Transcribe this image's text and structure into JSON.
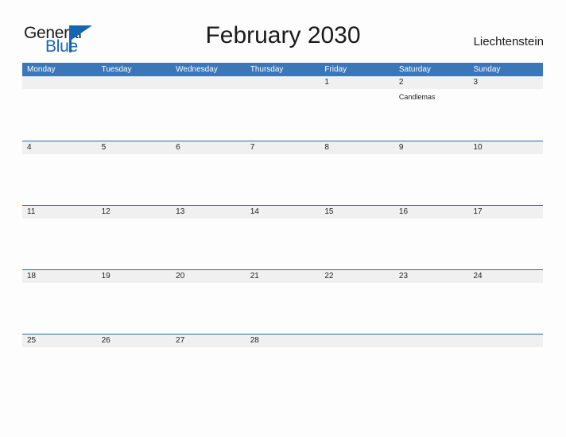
{
  "brand": {
    "name_part1": "General",
    "name_part2": "Blue",
    "accent_color": "#1565b0"
  },
  "header": {
    "title": "February 2030",
    "region": "Liechtenstein"
  },
  "theme": {
    "weekday_header_bg": "#3a76b8",
    "week_separator": "#2e6da4",
    "date_band_bg": "#f0f0f0",
    "page_bg": "#fdfdfd"
  },
  "calendar": {
    "weekdays": [
      "Monday",
      "Tuesday",
      "Wednesday",
      "Thursday",
      "Friday",
      "Saturday",
      "Sunday"
    ],
    "weeks": [
      [
        {
          "day": "",
          "event": ""
        },
        {
          "day": "",
          "event": ""
        },
        {
          "day": "",
          "event": ""
        },
        {
          "day": "",
          "event": ""
        },
        {
          "day": "1",
          "event": ""
        },
        {
          "day": "2",
          "event": "Candlemas"
        },
        {
          "day": "3",
          "event": ""
        }
      ],
      [
        {
          "day": "4",
          "event": ""
        },
        {
          "day": "5",
          "event": ""
        },
        {
          "day": "6",
          "event": ""
        },
        {
          "day": "7",
          "event": ""
        },
        {
          "day": "8",
          "event": ""
        },
        {
          "day": "9",
          "event": ""
        },
        {
          "day": "10",
          "event": ""
        }
      ],
      [
        {
          "day": "11",
          "event": ""
        },
        {
          "day": "12",
          "event": ""
        },
        {
          "day": "13",
          "event": ""
        },
        {
          "day": "14",
          "event": ""
        },
        {
          "day": "15",
          "event": ""
        },
        {
          "day": "16",
          "event": ""
        },
        {
          "day": "17",
          "event": ""
        }
      ],
      [
        {
          "day": "18",
          "event": ""
        },
        {
          "day": "19",
          "event": ""
        },
        {
          "day": "20",
          "event": ""
        },
        {
          "day": "21",
          "event": ""
        },
        {
          "day": "22",
          "event": ""
        },
        {
          "day": "23",
          "event": ""
        },
        {
          "day": "24",
          "event": ""
        }
      ],
      [
        {
          "day": "25",
          "event": ""
        },
        {
          "day": "26",
          "event": ""
        },
        {
          "day": "27",
          "event": ""
        },
        {
          "day": "28",
          "event": ""
        },
        {
          "day": "",
          "event": ""
        },
        {
          "day": "",
          "event": ""
        },
        {
          "day": "",
          "event": ""
        }
      ]
    ]
  }
}
